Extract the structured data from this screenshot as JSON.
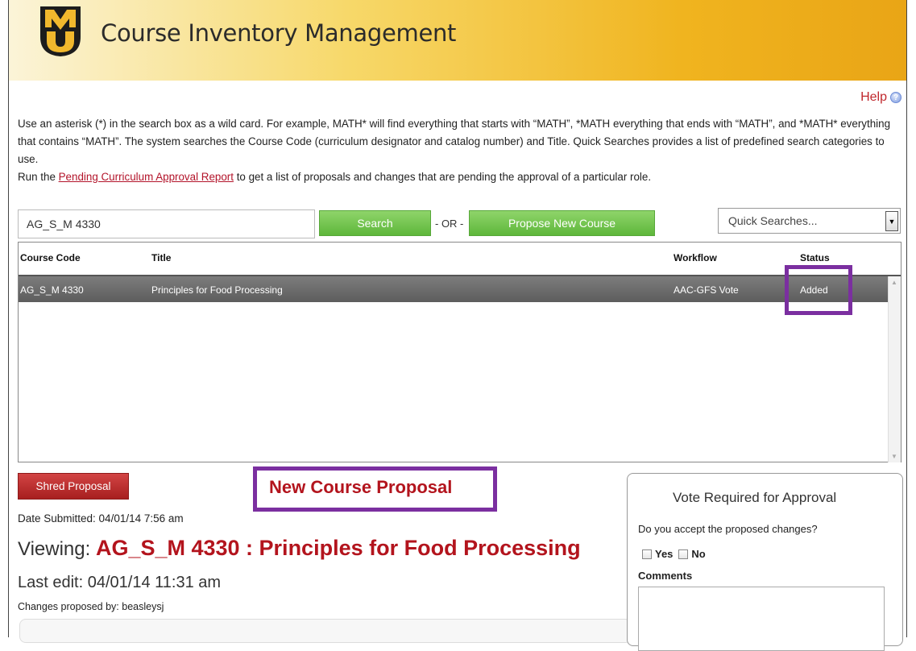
{
  "header": {
    "title": "Course Inventory Management"
  },
  "help": {
    "label": "Help",
    "icon": "help-icon"
  },
  "instructions": {
    "line1": "Use an asterisk (*) in the search box as a wild card. For example, MATH* will find everything that starts with “MATH”, *MATH everything that ends with “MATH”, and *MATH* everything that contains “MATH”. The system searches the Course Code (curriculum designator and catalog number) and Title. Quick Searches provides a list of predefined search categories to use.",
    "line2_pre": "Run the ",
    "line2_link": "Pending Curriculum Approval Report",
    "line2_post": " to get a list of proposals and changes that are pending the approval of a particular role."
  },
  "search": {
    "value": "AG_S_M 4330",
    "search_label": "Search",
    "or_label": "- OR -",
    "propose_label": "Propose New Course",
    "quick_label": "Quick Searches..."
  },
  "grid": {
    "columns": [
      "Course Code",
      "Title",
      "Workflow",
      "Status"
    ],
    "rows": [
      {
        "code": "AG_S_M 4330",
        "title": "Principles for Food Processing",
        "workflow": "AAC-GFS Vote",
        "status": "Added"
      }
    ]
  },
  "proposal": {
    "shred_label": "Shred Proposal",
    "heading": "New Course Proposal",
    "date_submitted": "Date Submitted: 04/01/14 7:56 am",
    "viewing_label": "Viewing:",
    "viewing_value": "AG_S_M 4330 : Principles for Food Processing",
    "last_edit": "Last edit: 04/01/14 11:31 am",
    "changes_by": "Changes proposed by: beasleysj"
  },
  "vote": {
    "title": "Vote Required for Approval",
    "question": "Do you accept the proposed changes?",
    "yes_label": "Yes",
    "no_label": "No",
    "comments_label": "Comments"
  },
  "colors": {
    "accent_red": "#b3141d",
    "green_button": "#5eb73b",
    "highlight_purple": "#7b2fa0",
    "header_gold": "#f0b41f"
  }
}
